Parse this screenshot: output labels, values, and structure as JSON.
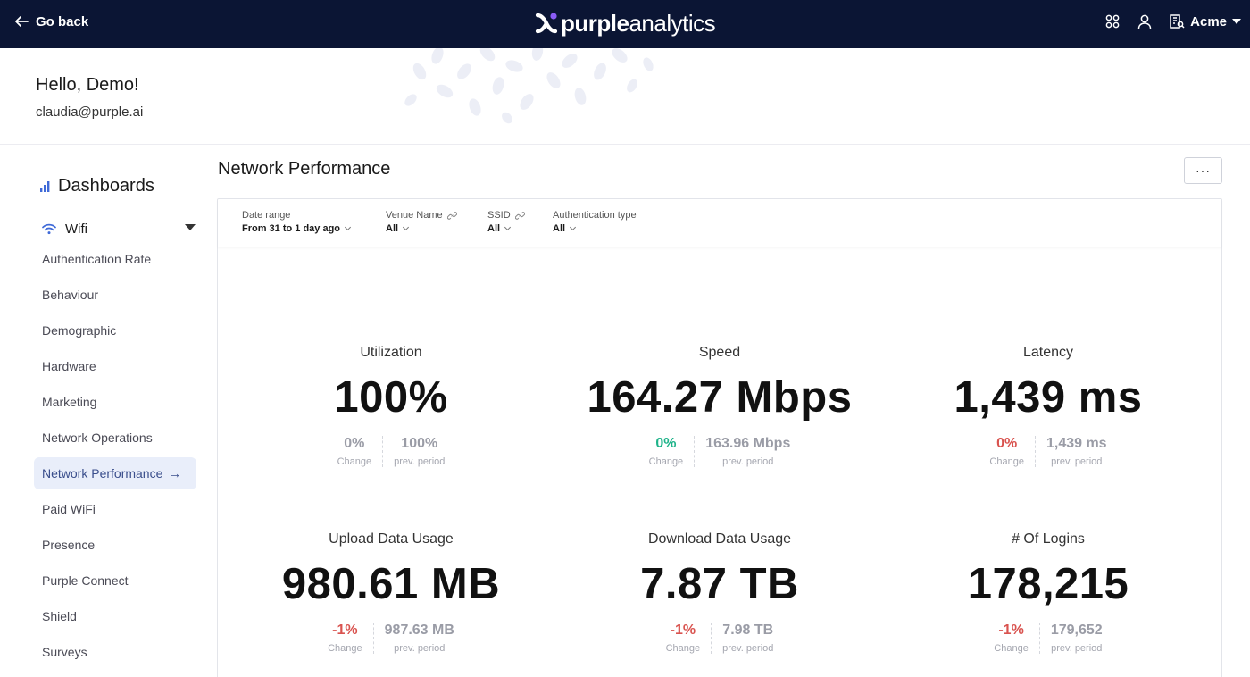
{
  "topbar": {
    "go_back_label": "Go back",
    "logo_bold": "purple",
    "logo_light": "analytics",
    "account_label": "Acme"
  },
  "greeting": {
    "hello": "Hello, Demo!",
    "email": "claudia@purple.ai"
  },
  "sidebar": {
    "title": "Dashboards",
    "section": "Wifi",
    "items": [
      {
        "label": "Authentication Rate",
        "active": false
      },
      {
        "label": "Behaviour",
        "active": false
      },
      {
        "label": "Demographic",
        "active": false
      },
      {
        "label": "Hardware",
        "active": false
      },
      {
        "label": "Marketing",
        "active": false
      },
      {
        "label": "Network Operations",
        "active": false
      },
      {
        "label": "Network Performance",
        "active": true
      },
      {
        "label": "Paid WiFi",
        "active": false
      },
      {
        "label": "Presence",
        "active": false
      },
      {
        "label": "Purple Connect",
        "active": false
      },
      {
        "label": "Shield",
        "active": false
      },
      {
        "label": "Surveys",
        "active": false
      }
    ]
  },
  "main": {
    "title": "Network Performance",
    "more_label": "···"
  },
  "filters": {
    "date_range": {
      "label": "Date range",
      "value": "From 31 to 1 day ago"
    },
    "venue_name": {
      "label": "Venue Name",
      "value": "All"
    },
    "ssid": {
      "label": "SSID",
      "value": "All"
    },
    "auth_type": {
      "label": "Authentication type",
      "value": "All"
    }
  },
  "metrics": [
    {
      "title": "Utilization",
      "value": "100%",
      "change": "0%",
      "change_label": "Change",
      "prev": "100%",
      "prev_label": "prev. period",
      "trend": "neutral"
    },
    {
      "title": "Speed",
      "value": "164.27 Mbps",
      "change": "0%",
      "change_label": "Change",
      "prev": "163.96 Mbps",
      "prev_label": "prev. period",
      "trend": "green"
    },
    {
      "title": "Latency",
      "value": "1,439 ms",
      "change": "0%",
      "change_label": "Change",
      "prev": "1,439 ms",
      "prev_label": "prev. period",
      "trend": "red"
    },
    {
      "title": "Upload Data Usage",
      "value": "980.61 MB",
      "change": "-1%",
      "change_label": "Change",
      "prev": "987.63 MB",
      "prev_label": "prev. period",
      "trend": "red"
    },
    {
      "title": "Download Data Usage",
      "value": "7.87 TB",
      "change": "-1%",
      "change_label": "Change",
      "prev": "7.98 TB",
      "prev_label": "prev. period",
      "trend": "red"
    },
    {
      "title": "# Of Logins",
      "value": "178,215",
      "change": "-1%",
      "change_label": "Change",
      "prev": "179,652",
      "prev_label": "prev. period",
      "trend": "red"
    }
  ],
  "colors": {
    "topbar_bg": "#0b1534",
    "accent_purple": "#8b5cf6",
    "positive": "#1fb38a",
    "negative": "#d9534f",
    "active_nav_bg": "#e9eefa"
  }
}
